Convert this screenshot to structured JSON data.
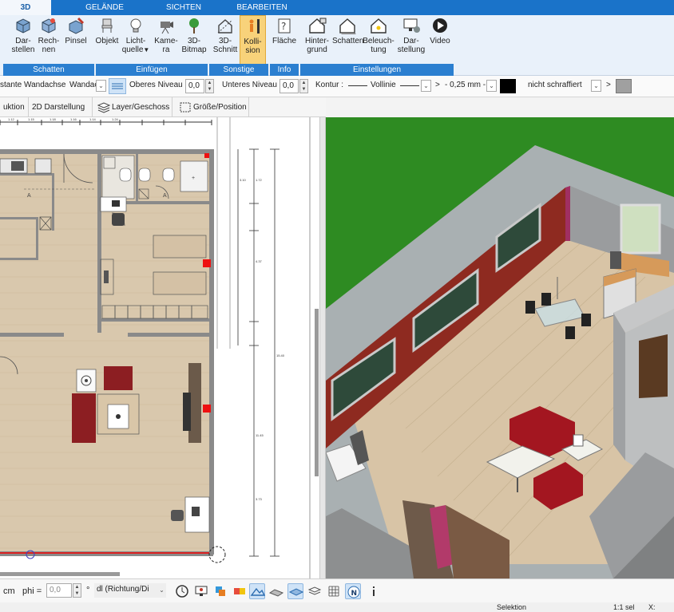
{
  "tabs": [
    {
      "label": "3D",
      "active": true
    },
    {
      "label": "GELÄNDE"
    },
    {
      "label": "SICHTEN"
    },
    {
      "label": "BEARBEITEN"
    }
  ],
  "ribbon": {
    "groups": [
      {
        "label": "Schatten"
      },
      {
        "label": "Einfügen"
      },
      {
        "label": "Sonstige"
      },
      {
        "label": "Info"
      },
      {
        "label": "Einstellungen"
      }
    ],
    "buttons": [
      {
        "l1": "Dar-",
        "l2": "stellen",
        "icon": "render-cube-icon"
      },
      {
        "l1": "Rech-",
        "l2": "nen",
        "icon": "calculate-cube-icon"
      },
      {
        "l1": "Pinsel",
        "l2": "",
        "icon": "brush-cube-icon"
      },
      {
        "l1": "Objekt",
        "l2": "",
        "icon": "chair-icon"
      },
      {
        "l1": "Licht-",
        "l2": "quelle",
        "icon": "lightbulb-icon"
      },
      {
        "l1": "Kame-",
        "l2": "ra",
        "icon": "camera-icon"
      },
      {
        "l1": "3D-",
        "l2": "Bitmap",
        "icon": "tree-icon"
      },
      {
        "l1": "3D-",
        "l2": "Schnitt",
        "icon": "section-house-icon"
      },
      {
        "l1": "Kolli-",
        "l2": "sion",
        "icon": "collision-person-icon",
        "selected": true
      },
      {
        "l1": "Fläche",
        "l2": "",
        "icon": "area-question-icon"
      },
      {
        "l1": "Hinter-",
        "l2": "grund",
        "icon": "background-house-icon"
      },
      {
        "l1": "Schatten",
        "l2": "",
        "icon": "shadow-house-icon"
      },
      {
        "l1": "Beleuch-",
        "l2": "tung",
        "icon": "lighting-house-icon"
      },
      {
        "l1": "Dar-",
        "l2": "stellung",
        "icon": "display-monitor-icon"
      },
      {
        "l1": "Video",
        "l2": "",
        "icon": "video-play-icon"
      }
    ]
  },
  "propbar": {
    "wall_axis_label": "stante Wandachse",
    "wall_axis_value": "Wandac",
    "upper_level_label": "Oberes Niveau",
    "upper_level_value": "0,0",
    "lower_level_label": "Unteres Niveau",
    "lower_level_value": "0,0",
    "contour_label": "Kontur :",
    "line_style": "Vollinie",
    "gt1": ">",
    "line_width": "- 0,25 mm -",
    "hatch": "nicht schraffiert",
    "gt2": ">",
    "fill_color": "#000000",
    "hatch_color": "#a0a0a0"
  },
  "toolbar2": {
    "construction": "uktion",
    "view2d": "2D Darstellung",
    "layer": "Layer/Geschoss",
    "size": "Größe/Position"
  },
  "plan": {
    "dim_labels": [
      "1.12",
      "1.15",
      "1.18",
      "1.16",
      "1.14",
      "1.24",
      "3.10",
      "2.46",
      "1.72",
      "2.05",
      "4.37",
      "1.38",
      "15.40",
      "11.45",
      "3.73"
    ]
  },
  "bottombar": {
    "unit": "cm",
    "phi_label": "phi =",
    "phi_value": "0,0",
    "deg": "°",
    "direction": "dl (Richtung/Di",
    "icons": [
      "clock-icon",
      "monitor-person-icon",
      "layers-color-icon",
      "terrain-icon",
      "terrain-alt-icon",
      "plane-icon",
      "stack-icon",
      "grid-icon",
      "north-icon",
      "info-vertical-icon"
    ]
  },
  "status": {
    "mode": "Selektion",
    "scale": "1:1 sel",
    "x_label": "X:"
  },
  "colors": {
    "accent": "#1a73c9",
    "ribbon_group": "#2b7fd0",
    "selected_button": "#f8d27a",
    "grass": "#2e8b22",
    "red_wall": "#8e2a20",
    "floor": "#d6c3a6"
  }
}
